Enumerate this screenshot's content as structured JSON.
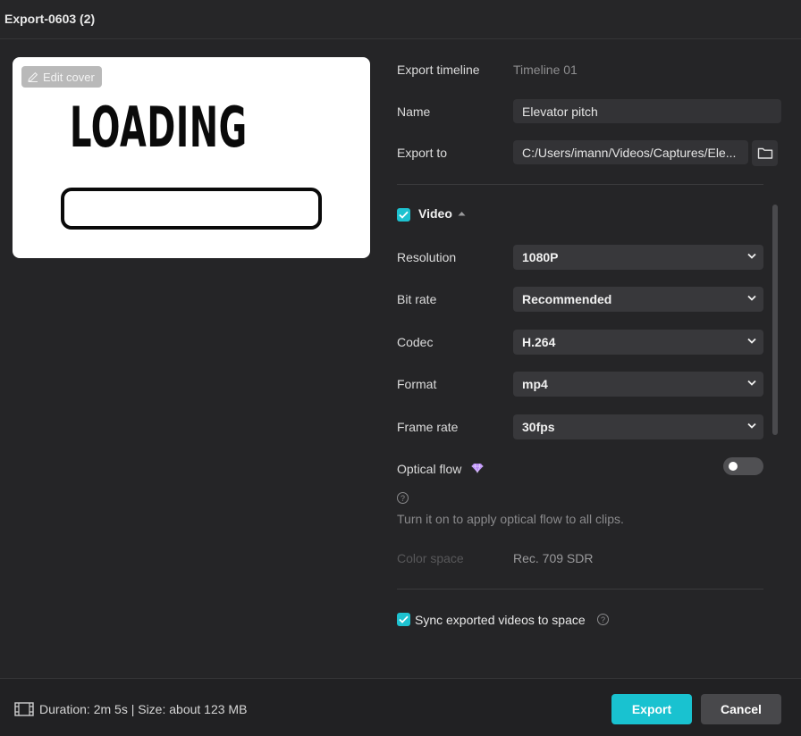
{
  "window": {
    "title": "Export-0603 (2)"
  },
  "cover": {
    "edit_label": "Edit cover",
    "loading_text": "LOADING"
  },
  "export_timeline": {
    "label": "Export timeline",
    "value": "Timeline 01"
  },
  "name": {
    "label": "Name",
    "value": "Elevator pitch"
  },
  "export_to": {
    "label": "Export to",
    "value": "C:/Users/imann/Videos/Captures/Ele..."
  },
  "video": {
    "enabled": true,
    "label": "Video",
    "resolution": {
      "label": "Resolution",
      "value": "1080P"
    },
    "bit_rate": {
      "label": "Bit rate",
      "value": "Recommended"
    },
    "codec": {
      "label": "Codec",
      "value": "H.264"
    },
    "format": {
      "label": "Format",
      "value": "mp4"
    },
    "frame_rate": {
      "label": "Frame rate",
      "value": "30fps"
    },
    "optical_flow": {
      "label": "Optical flow",
      "enabled": false,
      "hint": "Turn it on to apply optical flow to all clips."
    },
    "color_space": {
      "label": "Color space",
      "value": "Rec. 709 SDR"
    }
  },
  "sync": {
    "checked": true,
    "label": "Sync exported videos to space"
  },
  "footer": {
    "info": "Duration: 2m 5s | Size: about 123 MB",
    "export_label": "Export",
    "cancel_label": "Cancel"
  },
  "colors": {
    "accent": "#1ec2d0",
    "background": "#252527"
  }
}
